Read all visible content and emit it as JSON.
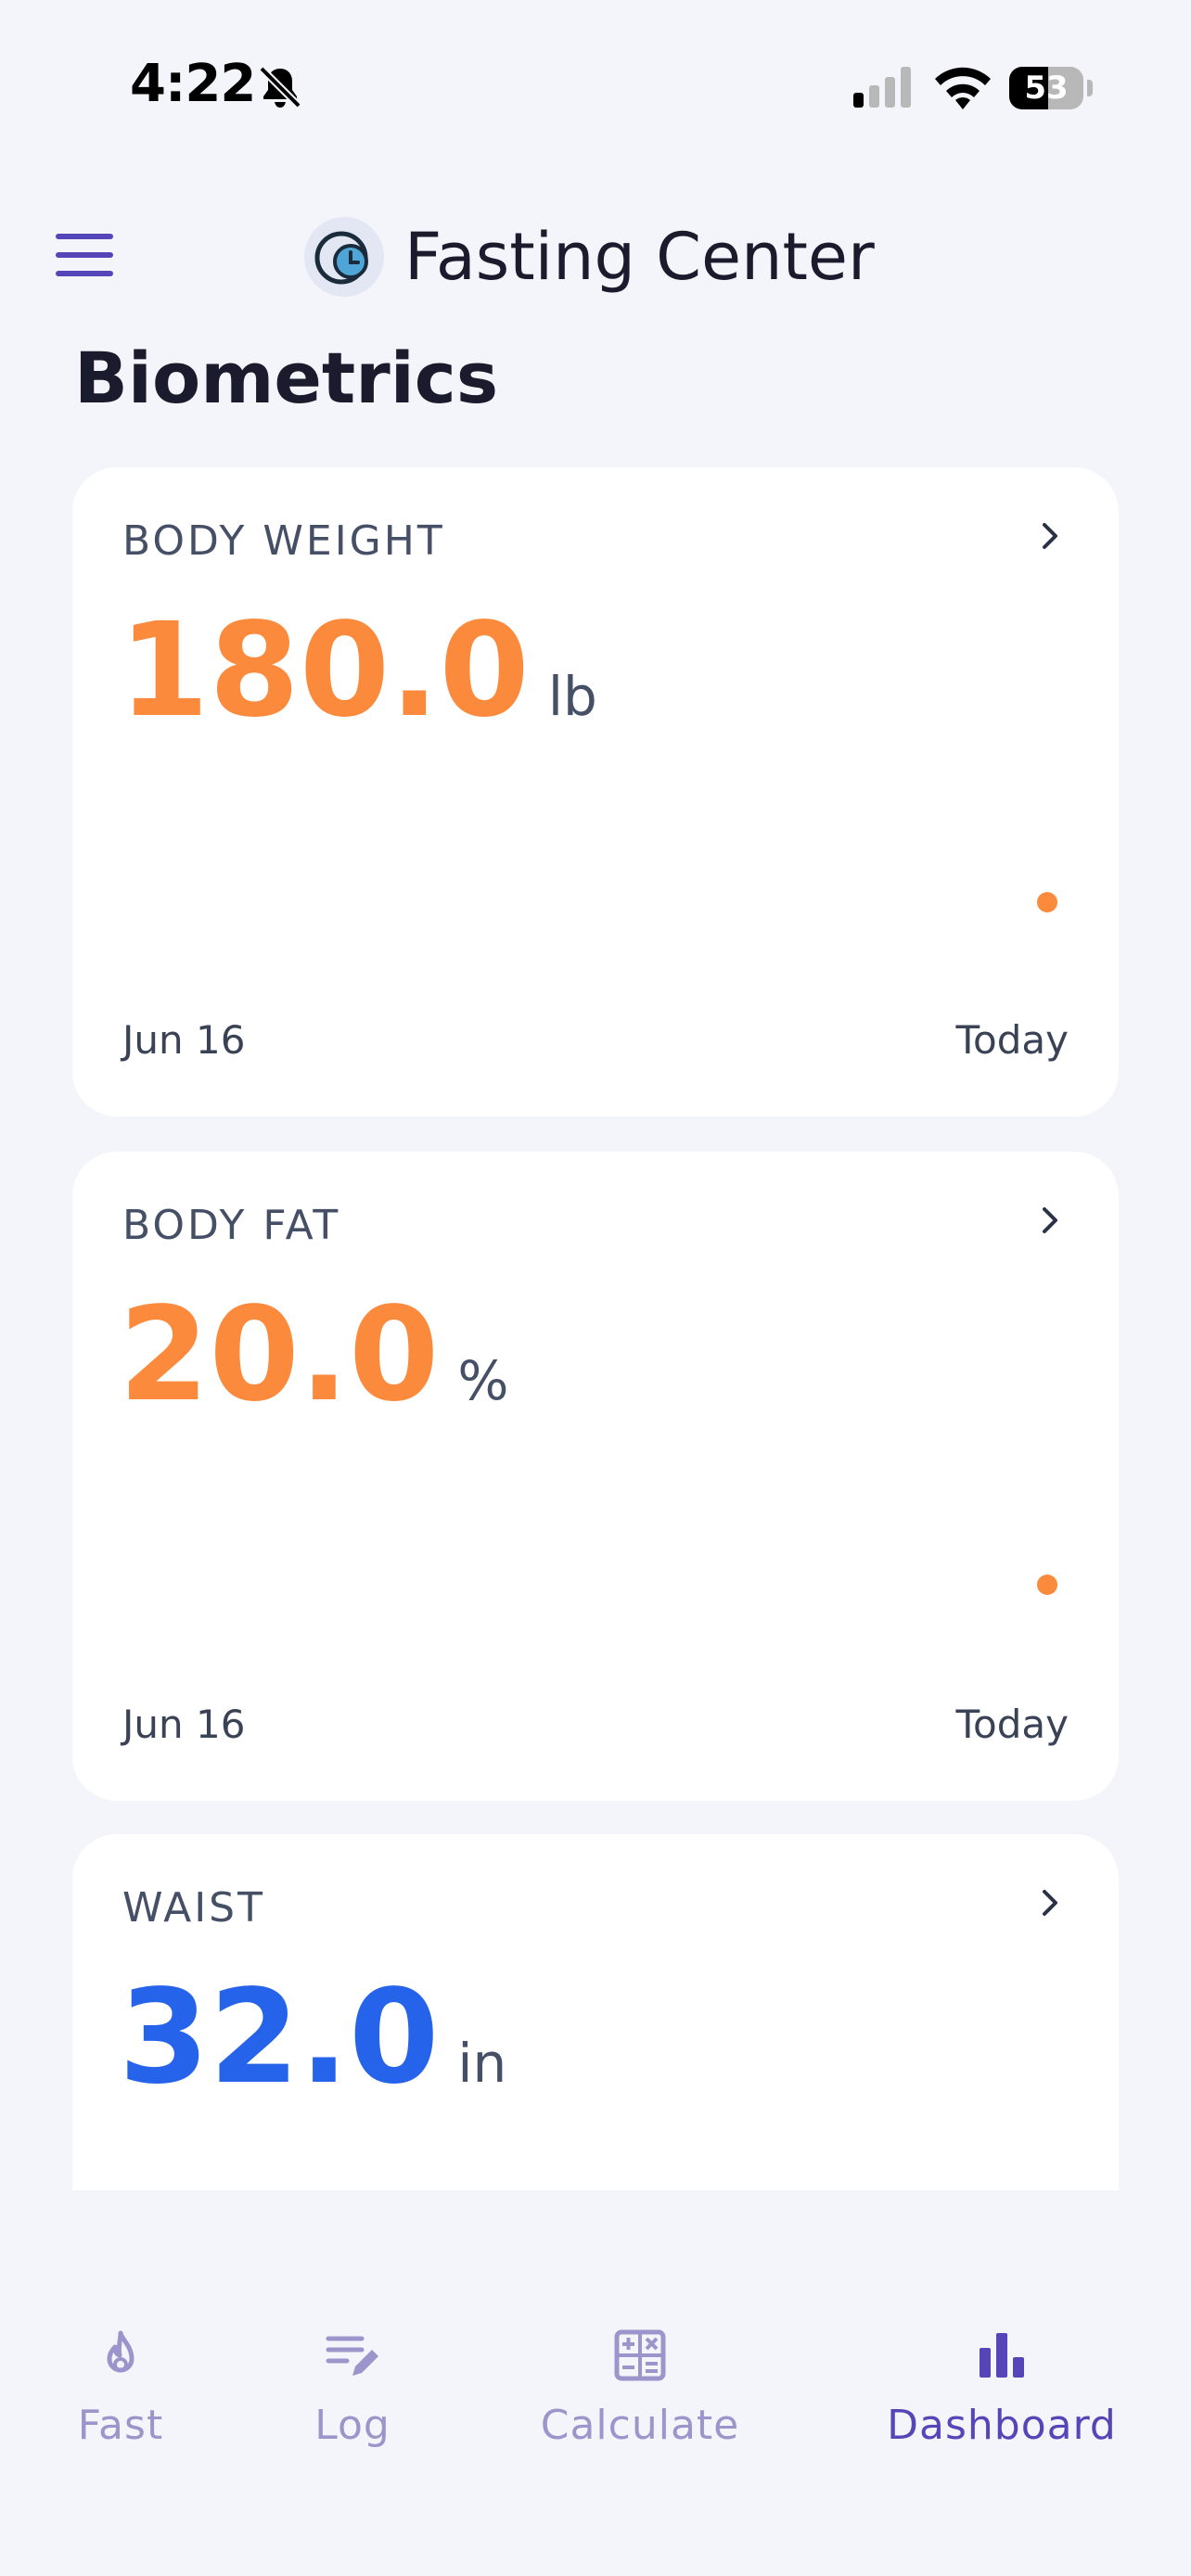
{
  "status_bar": {
    "time": "4:22",
    "battery": "53",
    "battery_fraction": 0.53
  },
  "header": {
    "title": "Fasting Center",
    "menu_icon": "hamburger-menu-icon",
    "logo_icon": "clock-logo-icon"
  },
  "page": {
    "title": "Biometrics"
  },
  "cards": [
    {
      "label": "BODY WEIGHT",
      "value": "180.0",
      "unit": "lb",
      "accent": "#fb8a3c",
      "start_label": "Jun 16",
      "end_label": "Today"
    },
    {
      "label": "BODY FAT",
      "value": "20.0",
      "unit": "%",
      "accent": "#fb8a3c",
      "start_label": "Jun 16",
      "end_label": "Today"
    },
    {
      "label": "WAIST",
      "value": "32.0",
      "unit": "in",
      "accent": "#2563eb"
    }
  ],
  "nav": {
    "items": [
      {
        "label": "Fast",
        "icon": "flame-icon",
        "active": false
      },
      {
        "label": "Log",
        "icon": "edit-list-icon",
        "active": false
      },
      {
        "label": "Calculate",
        "icon": "calculator-icon",
        "active": false
      },
      {
        "label": "Dashboard",
        "icon": "bar-chart-icon",
        "active": true
      }
    ]
  },
  "colors": {
    "background": "#f4f5fa",
    "brand": "#5446b8",
    "inactive_nav": "#9a96cc",
    "orange": "#fb8a3c",
    "blue": "#2563eb",
    "label": "#454f66"
  }
}
